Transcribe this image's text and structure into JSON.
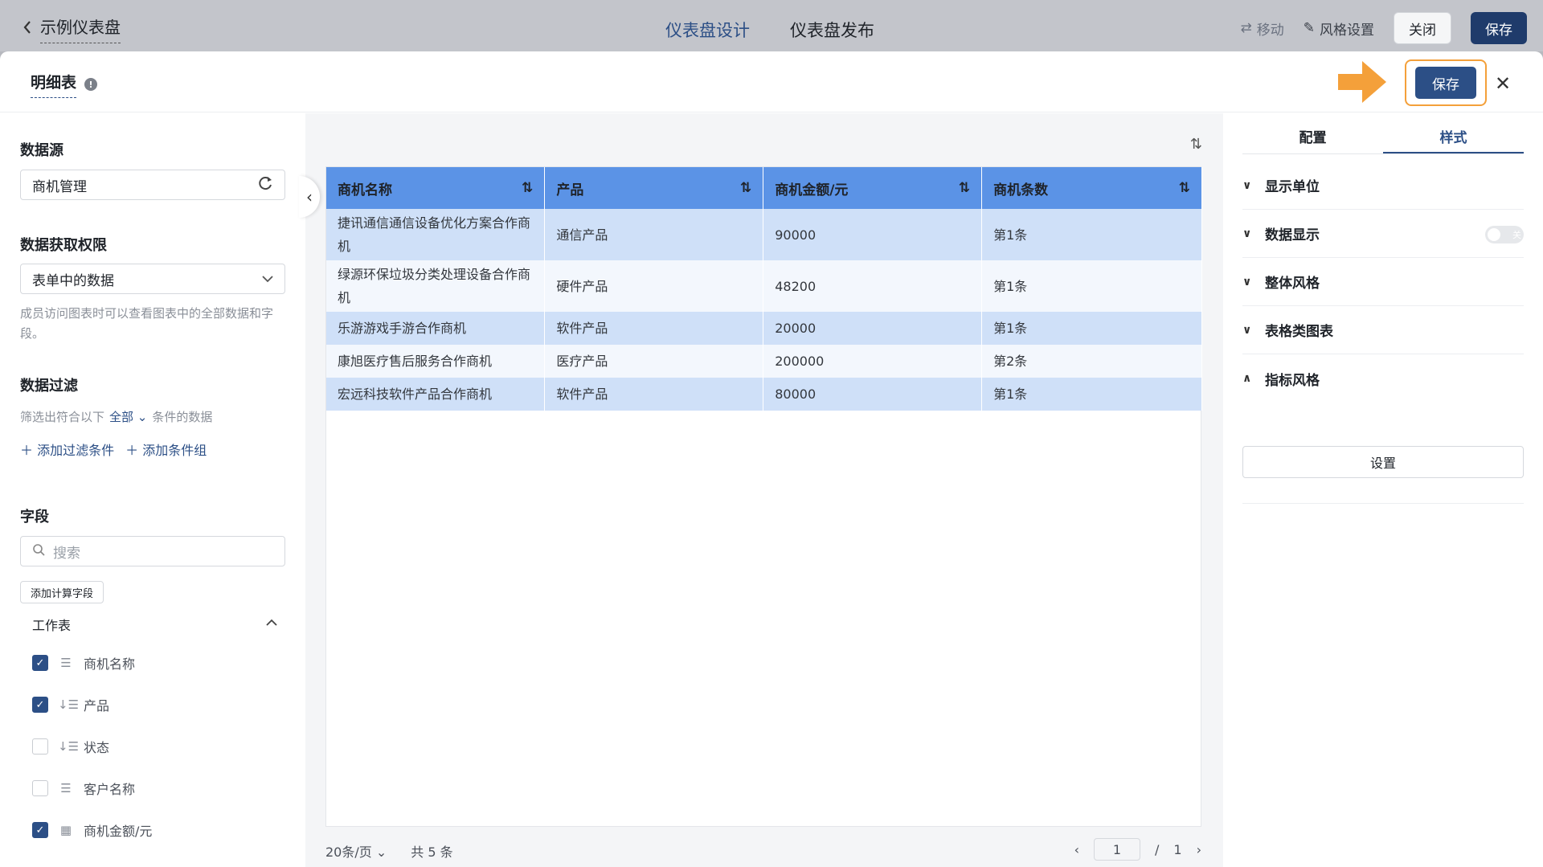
{
  "topbar": {
    "back_title": "示例仪表盘",
    "tab_design": "仪表盘设计",
    "tab_publish": "仪表盘发布",
    "move": "移动",
    "style_settings": "风格设置",
    "close": "关闭",
    "save": "保存"
  },
  "modal": {
    "title": "明细表",
    "save": "保存"
  },
  "left": {
    "datasource_title": "数据源",
    "datasource_value": "商机管理",
    "permission_title": "数据获取权限",
    "permission_value": "表单中的数据",
    "permission_hint": "成员访问图表时可以查看图表中的全部数据和字段。",
    "filter_title": "数据过滤",
    "filter_prefix": "筛选出符合以下",
    "filter_mode": "全部",
    "filter_suffix": "条件的数据",
    "add_filter": "添加过滤条件",
    "add_group": "添加条件组",
    "fields_title": "字段",
    "search_placeholder": "搜索",
    "add_calc_field": "添加计算字段",
    "worksheet": "工作表",
    "fields": [
      {
        "name": "商机名称",
        "checked": true,
        "icon": "text-icon"
      },
      {
        "name": "产品",
        "checked": true,
        "icon": "select-icon"
      },
      {
        "name": "状态",
        "checked": false,
        "icon": "select-icon"
      },
      {
        "name": "客户名称",
        "checked": false,
        "icon": "text-icon"
      },
      {
        "name": "商机金额/元",
        "checked": true,
        "icon": "number-icon"
      }
    ]
  },
  "table": {
    "headers": [
      "商机名称",
      "产品",
      "商机金额/元",
      "商机条数"
    ],
    "rows": [
      [
        "捷讯通信通信设备优化方案合作商机",
        "通信产品",
        "90000",
        "第1条"
      ],
      [
        "绿源环保垃圾分类处理设备合作商机",
        "硬件产品",
        "48200",
        "第1条"
      ],
      [
        "乐游游戏手游合作商机",
        "软件产品",
        "20000",
        "第1条"
      ],
      [
        "康旭医疗售后服务合作商机",
        "医疗产品",
        "200000",
        "第2条"
      ],
      [
        "宏远科技软件产品合作商机",
        "软件产品",
        "80000",
        "第1条"
      ]
    ],
    "page_size": "20条/页",
    "total": "共 5 条",
    "current_page": "1",
    "slash": "/",
    "total_pages": "1"
  },
  "right": {
    "tab_config": "配置",
    "tab_style": "样式",
    "sections": [
      "显示单位",
      "数据显示",
      "整体风格",
      "表格类图表",
      "指标风格"
    ],
    "toggle_label": "关",
    "set_button": "设置"
  },
  "colors": {
    "accent": "#2c4f86",
    "header_blue": "#5b93e6",
    "row_blue": "#cfe0f8",
    "highlight": "#f4a03a"
  }
}
